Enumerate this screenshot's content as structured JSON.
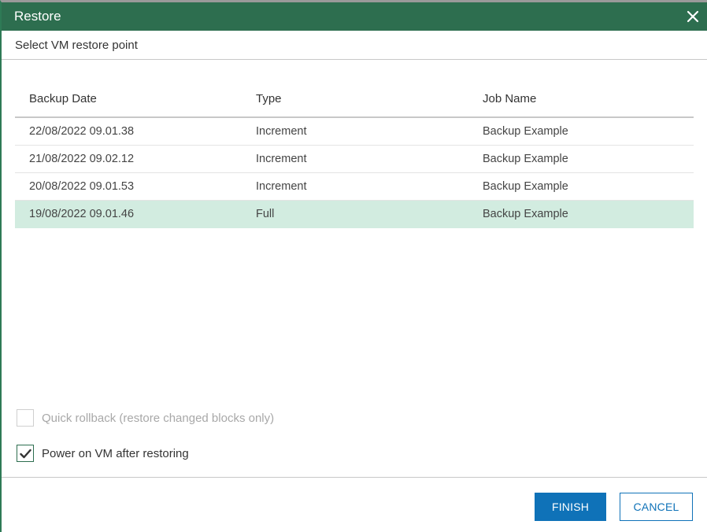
{
  "dialog": {
    "title": "Restore",
    "subtitle": "Select VM restore point"
  },
  "table": {
    "columns": [
      "Backup Date",
      "Type",
      "Job Name"
    ],
    "rows": [
      {
        "date": "22/08/2022 09.01.38",
        "type": "Increment",
        "job": "Backup Example",
        "selected": false
      },
      {
        "date": "21/08/2022 09.02.12",
        "type": "Increment",
        "job": "Backup Example",
        "selected": false
      },
      {
        "date": "20/08/2022 09.01.53",
        "type": "Increment",
        "job": "Backup Example",
        "selected": false
      },
      {
        "date": "19/08/2022 09.01.46",
        "type": "Full",
        "job": "Backup Example",
        "selected": true
      }
    ]
  },
  "options": {
    "quick_rollback": {
      "label": "Quick rollback (restore changed blocks only)",
      "checked": false,
      "enabled": false
    },
    "power_on": {
      "label": "Power on VM after restoring",
      "checked": true,
      "enabled": true
    }
  },
  "buttons": {
    "finish": "FINISH",
    "cancel": "CANCEL"
  },
  "colors": {
    "titlebar": "#2d6e4f",
    "selected_row": "#d2ece0",
    "primary": "#0f72b8"
  },
  "icons": {
    "close": "close-icon",
    "check": "checkmark-icon"
  }
}
